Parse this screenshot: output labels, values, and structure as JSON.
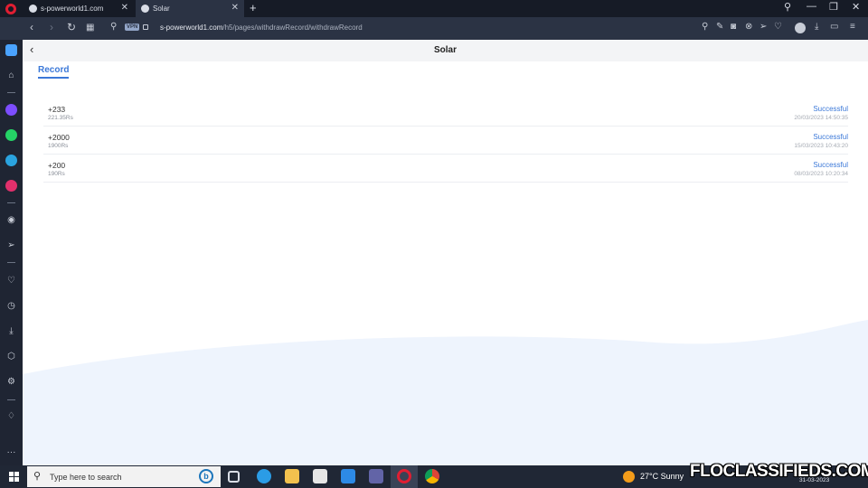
{
  "browser": {
    "tabs": [
      {
        "title": "s-powerworld1.com"
      },
      {
        "title": "Solar"
      }
    ],
    "new_tab": "+",
    "vpn_badge": "VPN",
    "url_host": "s-powerworld1.com",
    "url_path": "/h5/pages/withdrawRecord/withdrawRecord",
    "window_controls": {
      "search": "⚲",
      "minimize": "—",
      "restore": "❐",
      "close": "✕"
    }
  },
  "page": {
    "title": "Solar",
    "back_glyph": "‹",
    "tab_label": "Record",
    "records": [
      {
        "amount": "+233",
        "sub": "221.35Rs",
        "status": "Successful",
        "time": "20/03/2023 14:50:35"
      },
      {
        "amount": "+2000",
        "sub": "1900Rs",
        "status": "Successful",
        "time": "15/03/2023 10:43:20"
      },
      {
        "amount": "+200",
        "sub": "190Rs",
        "status": "Successful",
        "time": "08/03/2023 10:20:34"
      }
    ]
  },
  "taskbar": {
    "search_placeholder": "Type here to search",
    "weather_temp": "27°C",
    "weather_desc": "Sunny",
    "date": "31-03-2023"
  },
  "watermark": "FLOCLASSIFIEDS.COM",
  "colors": {
    "accent": "#3b78d8",
    "opera_red": "#e01e32",
    "sun": "#f39c1a"
  }
}
